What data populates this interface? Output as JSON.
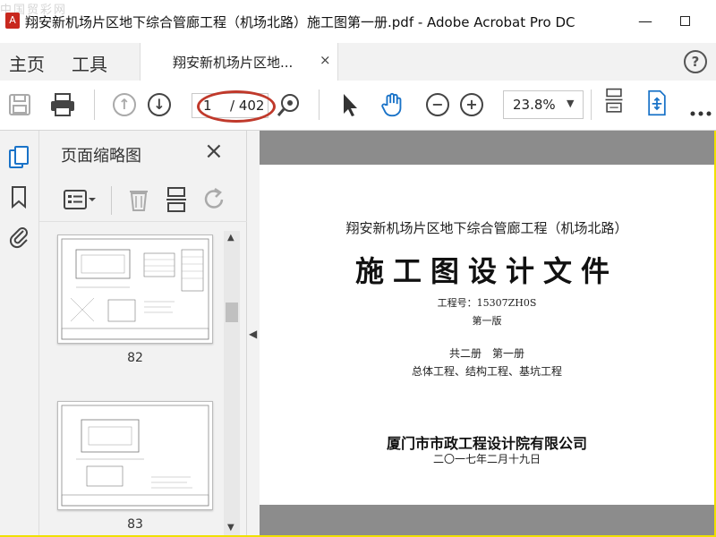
{
  "window": {
    "title": "翔安新机场片区地下综合管廊工程（机场北路）施工图第一册.pdf - Adobe Acrobat Pro DC",
    "watermark": "中国贸彩网",
    "minimize": "—"
  },
  "nav": {
    "home": "主页",
    "tools": "工具",
    "doc_tab": "翔安新机场片区地...",
    "tab_close": "×",
    "help": "?"
  },
  "toolbar": {
    "current_page": "1",
    "total_pages": "/ 402",
    "zoom": "23.8%",
    "zoom_arrow": "▼"
  },
  "panel": {
    "title": "页面缩略图",
    "close": "×",
    "thumbnails": [
      {
        "label": "82"
      },
      {
        "label": "83"
      }
    ]
  },
  "page": {
    "project": "翔安新机场片区地下综合管廊工程（机场北路）",
    "main_title": "施工图设计文件",
    "project_no": "工程号：15307ZH0S",
    "edition": "第一版",
    "volume": "共二册　第一册",
    "scope": "总体工程、结构工程、基坑工程",
    "organization": "厦门市市政工程设计院有限公司",
    "date": "二〇一七年二月十九日"
  },
  "colors": {
    "accent_blue": "#1a73c8",
    "highlight_red": "#c0392b",
    "frame_yellow": "#f0e000"
  }
}
